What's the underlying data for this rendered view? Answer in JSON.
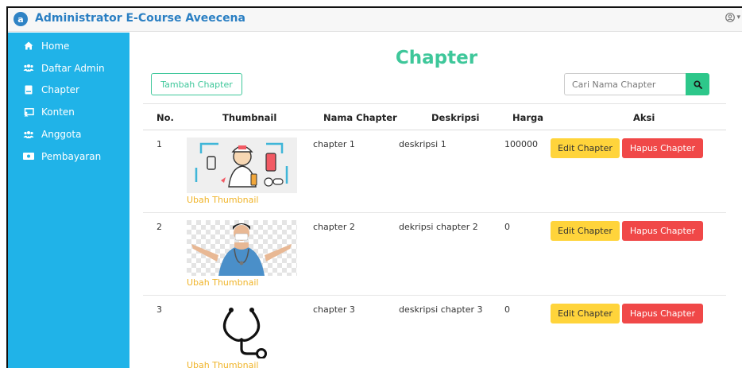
{
  "app": {
    "title": "Administrator E-Course Aveecena",
    "logo_letter": "a"
  },
  "user_menu": {
    "icon": "user-circle-icon",
    "caret": "▾"
  },
  "sidebar": {
    "items": [
      {
        "label": "Home",
        "icon": "home-icon"
      },
      {
        "label": "Daftar Admin",
        "icon": "users-cog-icon"
      },
      {
        "label": "Chapter",
        "icon": "book-icon"
      },
      {
        "label": "Konten",
        "icon": "chalkboard-icon"
      },
      {
        "label": "Anggota",
        "icon": "user-friends-icon"
      },
      {
        "label": "Pembayaran",
        "icon": "money-bill-icon"
      }
    ]
  },
  "page": {
    "title": "Chapter"
  },
  "toolbar": {
    "add_label": "Tambah Chapter",
    "search_placeholder": "Cari Nama Chapter"
  },
  "table": {
    "headers": [
      "No.",
      "Thumbnail",
      "Nama Chapter",
      "Deskripsi",
      "Harga",
      "Aksi"
    ],
    "rows": [
      {
        "no": "1",
        "name": "chapter 1",
        "desc": "deskripsi 1",
        "price": "100000",
        "thumb_link": "Ubah Thumbnail",
        "edit": "Edit Chapter",
        "delete": "Hapus Chapter"
      },
      {
        "no": "2",
        "name": "chapter 2",
        "desc": "dekripsi chapter 2",
        "price": "0",
        "thumb_link": "Ubah Thumbnail",
        "edit": "Edit Chapter",
        "delete": "Hapus Chapter"
      },
      {
        "no": "3",
        "name": "chapter 3",
        "desc": "deskripsi chapter 3",
        "price": "0",
        "thumb_link": "Ubah Thumbnail",
        "edit": "Edit Chapter",
        "delete": "Hapus Chapter"
      }
    ]
  },
  "colors": {
    "sidebar": "#20b3e8",
    "accent": "#3ec79a",
    "brand": "#2a7fc3",
    "edit": "#ffd43b",
    "delete": "#f04848",
    "link": "#f0b429"
  }
}
